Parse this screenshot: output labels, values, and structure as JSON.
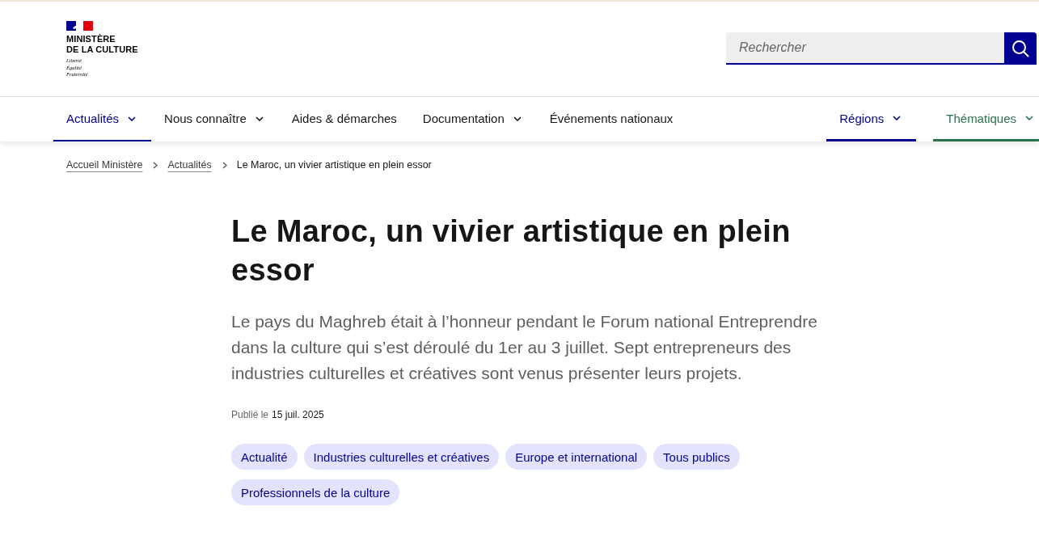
{
  "header": {
    "logo": {
      "title_lines": [
        "MINISTÈRE",
        "DE LA CULTURE"
      ],
      "motto_lines": [
        "Liberté",
        "Égalité",
        "Fraternité"
      ]
    },
    "search": {
      "placeholder": "Rechercher"
    }
  },
  "nav": {
    "items": [
      {
        "label": "Actualités",
        "selected": true,
        "dropdown": true
      },
      {
        "label": "Nous connaître",
        "selected": false,
        "dropdown": true
      },
      {
        "label": "Aides & démarches",
        "selected": false,
        "dropdown": false
      },
      {
        "label": "Documentation",
        "selected": false,
        "dropdown": true
      },
      {
        "label": "Événements nationaux",
        "selected": false,
        "dropdown": false
      }
    ],
    "secondary": [
      {
        "label": "Régions",
        "color": "#000091",
        "dropdown": true
      },
      {
        "label": "Thématiques",
        "color": "#2a7150",
        "dropdown": true
      }
    ]
  },
  "breadcrumb": [
    {
      "label": "Accueil Ministère",
      "kind": "link"
    },
    {
      "label": "Actualités",
      "kind": "link"
    },
    {
      "label": "Le Maroc, un vivier artistique en plein essor",
      "kind": "current"
    }
  ],
  "article": {
    "title": "Le Maroc, un vivier artistique en plein essor",
    "lead": "Le pays du Maghreb était à l’honneur pendant le Forum national Entreprendre dans la culture qui s’est déroulé du 1er au 3 juillet. Sept entrepreneurs des industries culturelles et créatives sont venus présenter leurs projets.",
    "published": {
      "label": "Publié le",
      "date": "15 juil. 2025"
    },
    "tags": [
      "Actualité",
      "Industries culturelles et créatives",
      "Europe et international",
      "Tous publics",
      "Professionnels de la culture"
    ]
  }
}
